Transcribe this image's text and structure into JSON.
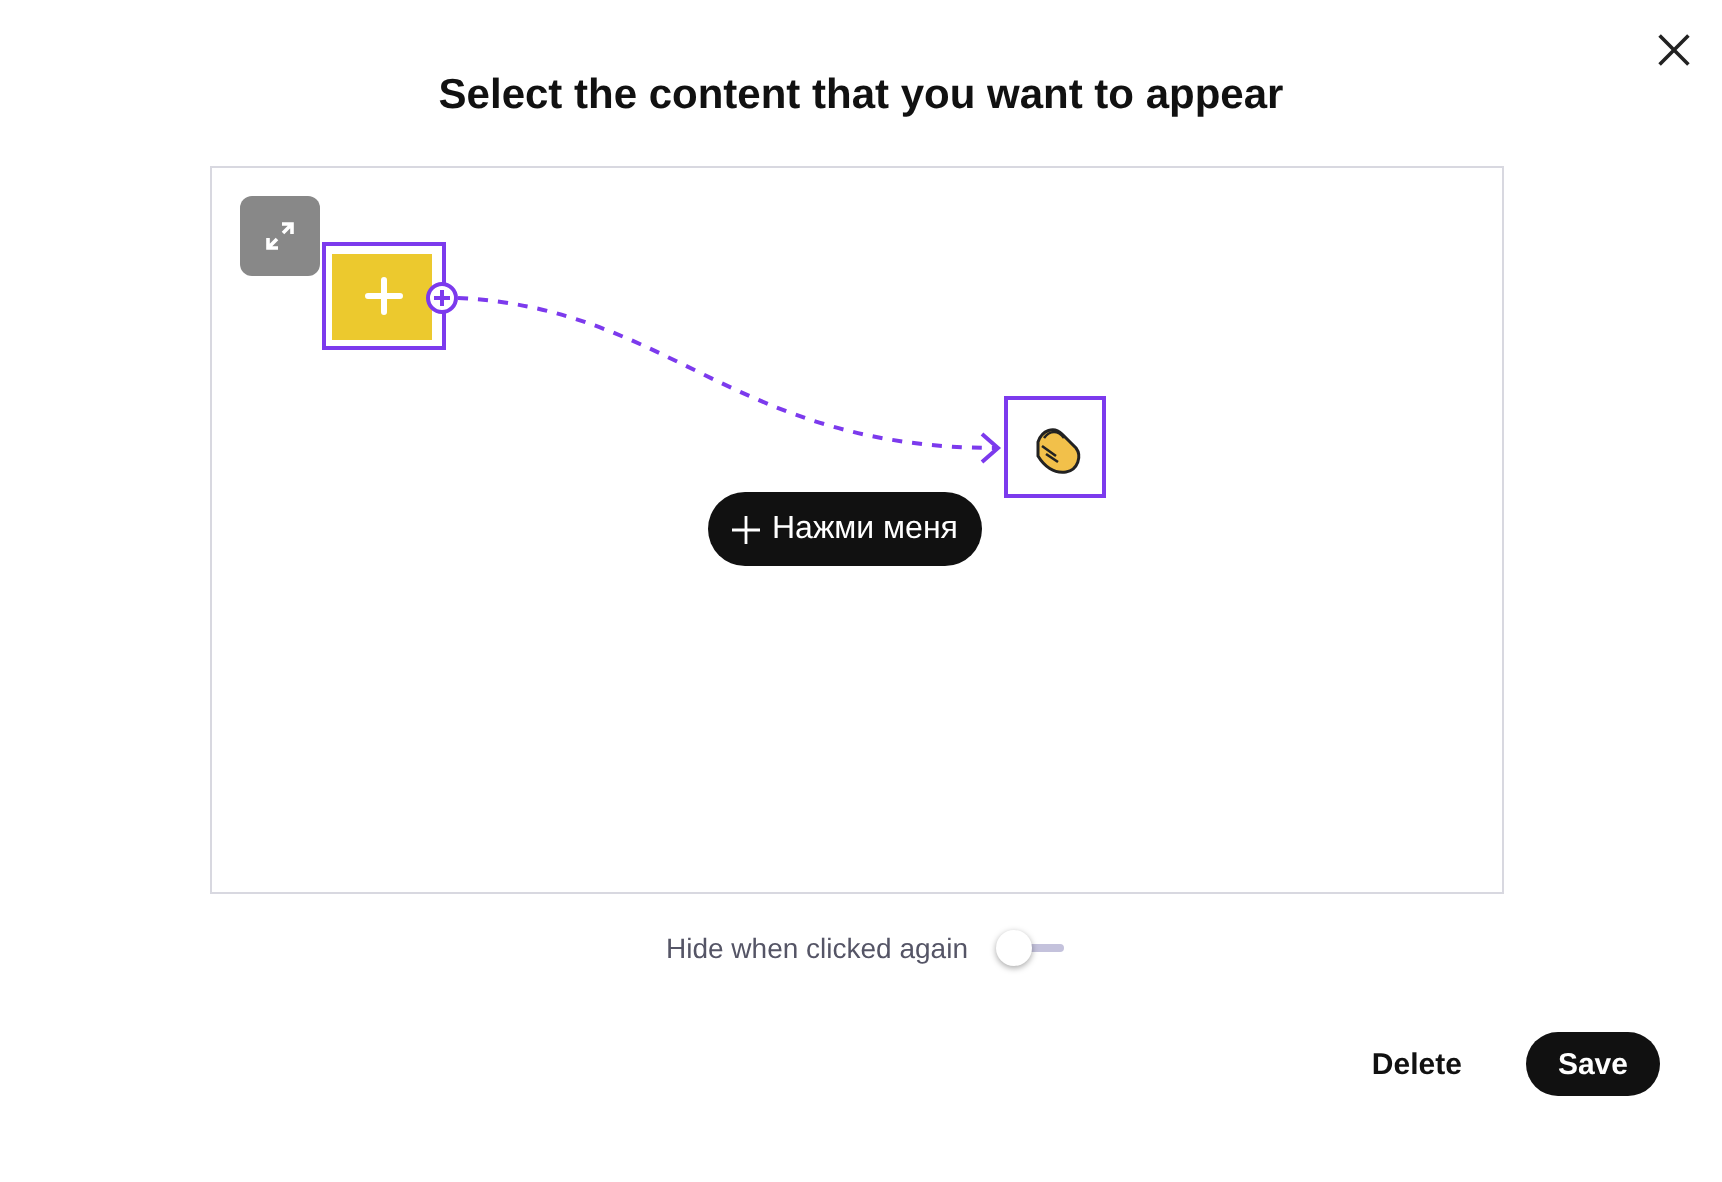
{
  "dialog": {
    "title": "Select the content that you want to appear"
  },
  "canvas": {
    "button_label": "Нажми меня"
  },
  "toggle": {
    "label": "Hide when clicked again",
    "on": false
  },
  "buttons": [
    {
      "label": "Delete",
      "kind": "text"
    },
    {
      "label": "Save",
      "kind": "primary"
    }
  ]
}
